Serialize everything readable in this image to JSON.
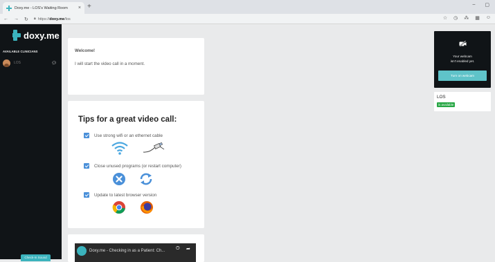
{
  "browser": {
    "tab_title": "Doxy.me - LOS's Waiting Room",
    "tab_close": "×",
    "new_tab": "+",
    "address_scheme": "https://",
    "address_host": "doxy.me",
    "address_path": "/los",
    "win_min": "–",
    "win_restore": "▢",
    "icons": [
      "star-icon",
      "history-icon",
      "extension-icon",
      "qr-icon",
      "profile-icon"
    ]
  },
  "sidebar": {
    "logo_text": "doxy.me",
    "section_label": "AVAILABLE CLINICIANS",
    "clinicians": [
      {
        "name": "LOS"
      }
    ],
    "bottom_button": "Check-In Sound"
  },
  "welcome": {
    "title": "Welcome!",
    "message": "I will start the video call in a moment."
  },
  "tips": {
    "title": "Tips for a great video call:",
    "items": [
      "Use strong wifi or an ethernet cable",
      "Close unused programs (or restart computer)",
      "Update to latest browser version"
    ]
  },
  "video": {
    "title": "Doxy.me - Checking in as a Patient: Ch..."
  },
  "webcam": {
    "message_line1": "Your webcam",
    "message_line2": "isn't enabled yet.",
    "button": "Turn on webcam"
  },
  "provider": {
    "name": "LOS",
    "status": "is available"
  },
  "colors": {
    "brand": "#3bb3bd",
    "sidebar_bg": "#101417",
    "available": "#28a745",
    "checkbox": "#4a90d9"
  }
}
